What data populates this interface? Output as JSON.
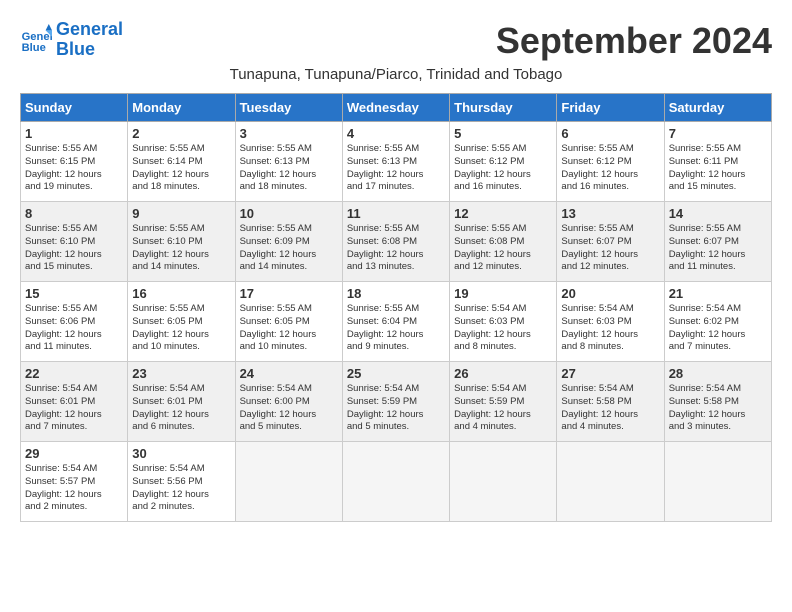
{
  "header": {
    "logo_line1": "General",
    "logo_line2": "Blue",
    "title": "September 2024",
    "subtitle": "Tunapuna, Tunapuna/Piarco, Trinidad and Tobago"
  },
  "weekdays": [
    "Sunday",
    "Monday",
    "Tuesday",
    "Wednesday",
    "Thursday",
    "Friday",
    "Saturday"
  ],
  "days": [
    {
      "date": 1,
      "col": 0,
      "sunrise": "5:55 AM",
      "sunset": "6:15 PM",
      "daylight": "12 hours and 19 minutes."
    },
    {
      "date": 2,
      "col": 1,
      "sunrise": "5:55 AM",
      "sunset": "6:14 PM",
      "daylight": "12 hours and 18 minutes."
    },
    {
      "date": 3,
      "col": 2,
      "sunrise": "5:55 AM",
      "sunset": "6:13 PM",
      "daylight": "12 hours and 18 minutes."
    },
    {
      "date": 4,
      "col": 3,
      "sunrise": "5:55 AM",
      "sunset": "6:13 PM",
      "daylight": "12 hours and 17 minutes."
    },
    {
      "date": 5,
      "col": 4,
      "sunrise": "5:55 AM",
      "sunset": "6:12 PM",
      "daylight": "12 hours and 16 minutes."
    },
    {
      "date": 6,
      "col": 5,
      "sunrise": "5:55 AM",
      "sunset": "6:12 PM",
      "daylight": "12 hours and 16 minutes."
    },
    {
      "date": 7,
      "col": 6,
      "sunrise": "5:55 AM",
      "sunset": "6:11 PM",
      "daylight": "12 hours and 15 minutes."
    },
    {
      "date": 8,
      "col": 0,
      "sunrise": "5:55 AM",
      "sunset": "6:10 PM",
      "daylight": "12 hours and 15 minutes."
    },
    {
      "date": 9,
      "col": 1,
      "sunrise": "5:55 AM",
      "sunset": "6:10 PM",
      "daylight": "12 hours and 14 minutes."
    },
    {
      "date": 10,
      "col": 2,
      "sunrise": "5:55 AM",
      "sunset": "6:09 PM",
      "daylight": "12 hours and 14 minutes."
    },
    {
      "date": 11,
      "col": 3,
      "sunrise": "5:55 AM",
      "sunset": "6:08 PM",
      "daylight": "12 hours and 13 minutes."
    },
    {
      "date": 12,
      "col": 4,
      "sunrise": "5:55 AM",
      "sunset": "6:08 PM",
      "daylight": "12 hours and 12 minutes."
    },
    {
      "date": 13,
      "col": 5,
      "sunrise": "5:55 AM",
      "sunset": "6:07 PM",
      "daylight": "12 hours and 12 minutes."
    },
    {
      "date": 14,
      "col": 6,
      "sunrise": "5:55 AM",
      "sunset": "6:07 PM",
      "daylight": "12 hours and 11 minutes."
    },
    {
      "date": 15,
      "col": 0,
      "sunrise": "5:55 AM",
      "sunset": "6:06 PM",
      "daylight": "12 hours and 11 minutes."
    },
    {
      "date": 16,
      "col": 1,
      "sunrise": "5:55 AM",
      "sunset": "6:05 PM",
      "daylight": "12 hours and 10 minutes."
    },
    {
      "date": 17,
      "col": 2,
      "sunrise": "5:55 AM",
      "sunset": "6:05 PM",
      "daylight": "12 hours and 10 minutes."
    },
    {
      "date": 18,
      "col": 3,
      "sunrise": "5:55 AM",
      "sunset": "6:04 PM",
      "daylight": "12 hours and 9 minutes."
    },
    {
      "date": 19,
      "col": 4,
      "sunrise": "5:54 AM",
      "sunset": "6:03 PM",
      "daylight": "12 hours and 8 minutes."
    },
    {
      "date": 20,
      "col": 5,
      "sunrise": "5:54 AM",
      "sunset": "6:03 PM",
      "daylight": "12 hours and 8 minutes."
    },
    {
      "date": 21,
      "col": 6,
      "sunrise": "5:54 AM",
      "sunset": "6:02 PM",
      "daylight": "12 hours and 7 minutes."
    },
    {
      "date": 22,
      "col": 0,
      "sunrise": "5:54 AM",
      "sunset": "6:01 PM",
      "daylight": "12 hours and 7 minutes."
    },
    {
      "date": 23,
      "col": 1,
      "sunrise": "5:54 AM",
      "sunset": "6:01 PM",
      "daylight": "12 hours and 6 minutes."
    },
    {
      "date": 24,
      "col": 2,
      "sunrise": "5:54 AM",
      "sunset": "6:00 PM",
      "daylight": "12 hours and 5 minutes."
    },
    {
      "date": 25,
      "col": 3,
      "sunrise": "5:54 AM",
      "sunset": "5:59 PM",
      "daylight": "12 hours and 5 minutes."
    },
    {
      "date": 26,
      "col": 4,
      "sunrise": "5:54 AM",
      "sunset": "5:59 PM",
      "daylight": "12 hours and 4 minutes."
    },
    {
      "date": 27,
      "col": 5,
      "sunrise": "5:54 AM",
      "sunset": "5:58 PM",
      "daylight": "12 hours and 4 minutes."
    },
    {
      "date": 28,
      "col": 6,
      "sunrise": "5:54 AM",
      "sunset": "5:58 PM",
      "daylight": "12 hours and 3 minutes."
    },
    {
      "date": 29,
      "col": 0,
      "sunrise": "5:54 AM",
      "sunset": "5:57 PM",
      "daylight": "12 hours and 2 minutes."
    },
    {
      "date": 30,
      "col": 1,
      "sunrise": "5:54 AM",
      "sunset": "5:56 PM",
      "daylight": "12 hours and 2 minutes."
    }
  ],
  "colors": {
    "header_bg": "#2874c8",
    "header_text": "#ffffff",
    "row_alt": "#f0f0f0"
  }
}
